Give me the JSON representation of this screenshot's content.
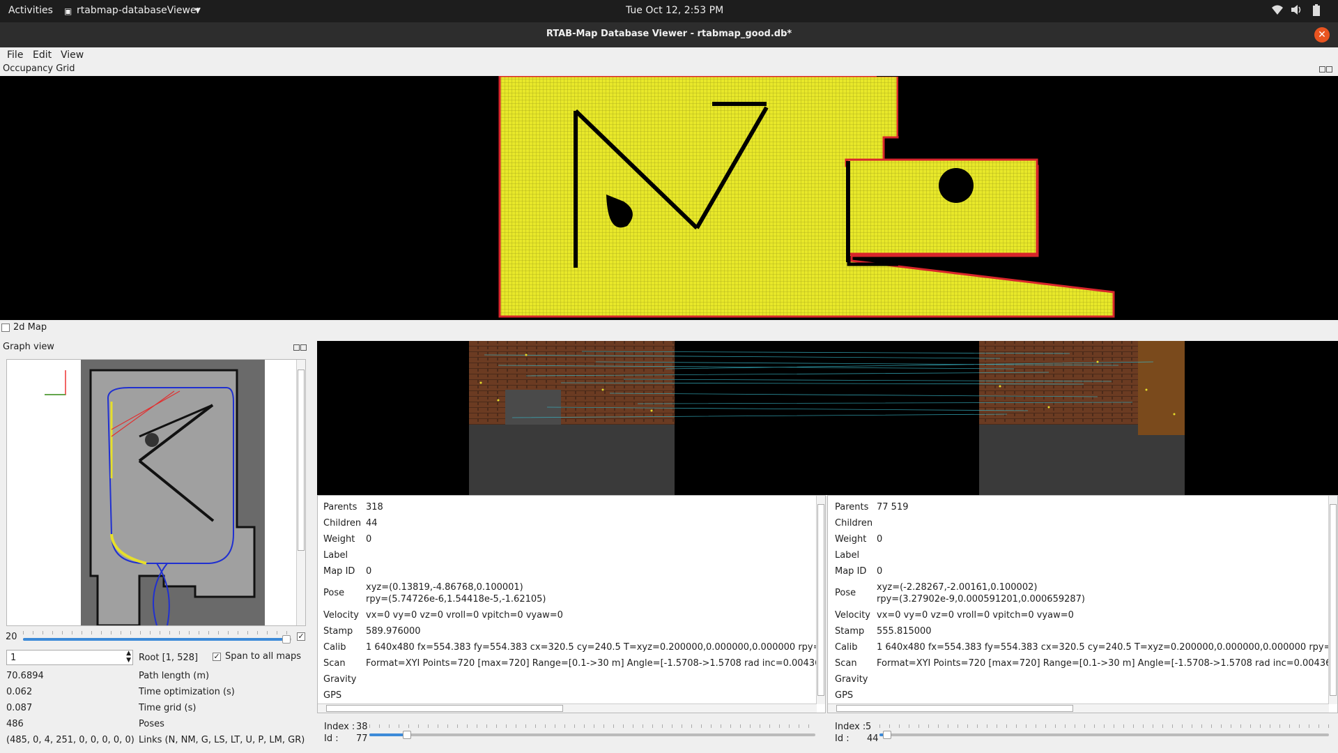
{
  "topbar": {
    "activities": "Activities",
    "app_name": "rtabmap-databaseViewer",
    "clock": "Tue Oct 12,  2:53 PM"
  },
  "window": {
    "title": "RTAB-Map Database Viewer - rtabmap_good.db*"
  },
  "menu": {
    "file": "File",
    "edit": "Edit",
    "view": "View"
  },
  "occupancy": {
    "title": "Occupancy Grid"
  },
  "map2d": {
    "label": "2d Map",
    "checked": false
  },
  "graph": {
    "title": "Graph view",
    "slider_value": "20",
    "spin_value": "1",
    "root": "Root [1, 528]",
    "span_label": "Span to all maps",
    "stats": [
      {
        "value": "70.6894",
        "label": "Path length (m)"
      },
      {
        "value": "0.062",
        "label": "Time optimization (s)"
      },
      {
        "value": "0.087",
        "label": "Time grid (s)"
      },
      {
        "value": "486",
        "label": "Poses"
      },
      {
        "value": "(485, 0, 4, 251, 0, 0, 0, 0, 0)",
        "label": "Links (N, NM, G, LS, LT, U, P, LM, GR)"
      }
    ]
  },
  "left_info": {
    "rows": [
      {
        "k": "Parents",
        "v": "318"
      },
      {
        "k": "Children",
        "v": "44"
      },
      {
        "k": "Weight",
        "v": "0"
      },
      {
        "k": "Label",
        "v": ""
      },
      {
        "k": "Map ID",
        "v": "0"
      },
      {
        "k": "Pose",
        "v": "xyz=(0.13819,-4.86768,0.100001)",
        "v2": "rpy=(5.74726e-6,1.54418e-5,-1.62105)"
      },
      {
        "k": "Velocity",
        "v": "vx=0 vy=0 vz=0 vroll=0 vpitch=0 vyaw=0"
      },
      {
        "k": "Stamp",
        "v": "589.976000"
      },
      {
        "k": "Calib",
        "v": "1 640x480 fx=554.383 fy=554.383 cx=320.5 cy=240.5 T=xyz=0.200000,0.000000,0.000000 rpy="
      },
      {
        "k": "Scan",
        "v": "Format=XYI Points=720 [max=720] Range=[0.1->30 m] Angle=[-1.5708->1.5708 rad inc=0.00436"
      },
      {
        "k": "Gravity",
        "v": ""
      },
      {
        "k": "GPS",
        "v": ""
      }
    ],
    "index_label": "Index :",
    "index": "38",
    "id_label": "Id :",
    "id": "77"
  },
  "right_info": {
    "rows": [
      {
        "k": "Parents",
        "v": "77 519"
      },
      {
        "k": "Children",
        "v": ""
      },
      {
        "k": "Weight",
        "v": "0"
      },
      {
        "k": "Label",
        "v": ""
      },
      {
        "k": "Map ID",
        "v": "0"
      },
      {
        "k": "Pose",
        "v": "xyz=(-2.28267,-2.00161,0.100002)",
        "v2": "rpy=(3.27902e-9,0.000591201,0.000659287)"
      },
      {
        "k": "Velocity",
        "v": "vx=0 vy=0 vz=0 vroll=0 vpitch=0 vyaw=0"
      },
      {
        "k": "Stamp",
        "v": "555.815000"
      },
      {
        "k": "Calib",
        "v": "1 640x480 fx=554.383 fy=554.383 cx=320.5 cy=240.5 T=xyz=0.200000,0.000000,0.000000 rpy="
      },
      {
        "k": "Scan",
        "v": "Format=XYI Points=720 [max=720] Range=[0.1->30 m] Angle=[-1.5708->1.5708 rad inc=0.00436"
      },
      {
        "k": "Gravity",
        "v": ""
      },
      {
        "k": "GPS",
        "v": ""
      }
    ],
    "index_label": "Index :",
    "index": "5",
    "id_label": "Id :",
    "id": "44"
  }
}
